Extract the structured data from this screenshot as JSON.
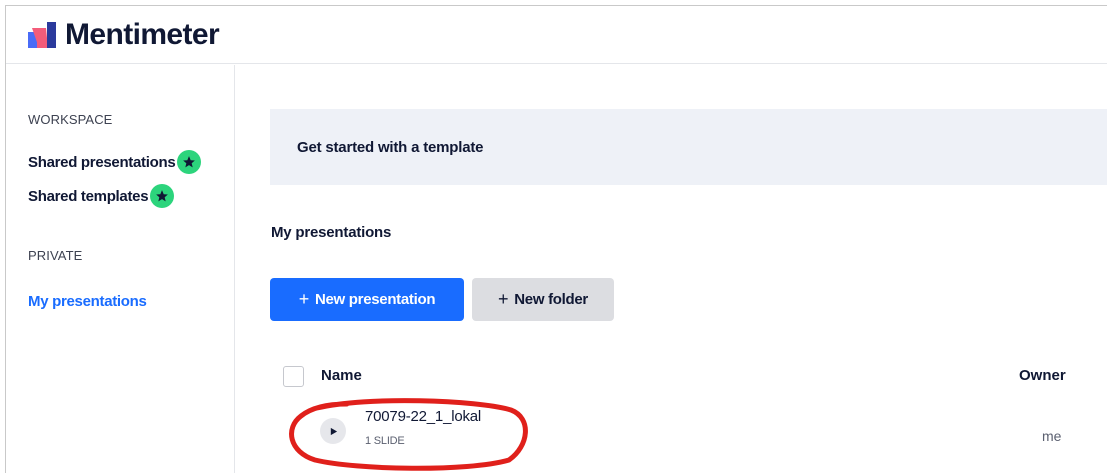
{
  "app": {
    "logo_text": "Mentimeter",
    "logo_icon": "mentimeter-logo"
  },
  "colors": {
    "accent": "#196cff",
    "badge": "#2cd47c",
    "banner_bg": "#eef1f7",
    "annotation": "#e0201b"
  },
  "sidebar": {
    "workspace_heading": "WORKSPACE",
    "workspace_items": [
      {
        "label": "Shared presentations",
        "icon": "star-icon"
      },
      {
        "label": "Shared templates",
        "icon": "star-icon"
      }
    ],
    "private_heading": "PRIVATE",
    "private_items": [
      {
        "label": "My presentations",
        "active": true
      }
    ]
  },
  "main": {
    "template_banner": "Get started with a template",
    "section_title": "My presentations",
    "buttons": {
      "new_presentation": {
        "icon": "+",
        "label": "New presentation"
      },
      "new_folder": {
        "icon": "+",
        "label": "New folder"
      }
    },
    "table": {
      "columns": [
        "Name",
        "Owner"
      ],
      "rows": [
        {
          "title": "70079-22_1_lokal",
          "subtitle": "1 SLIDE",
          "owner": "me",
          "icon": "play-icon"
        }
      ]
    }
  }
}
